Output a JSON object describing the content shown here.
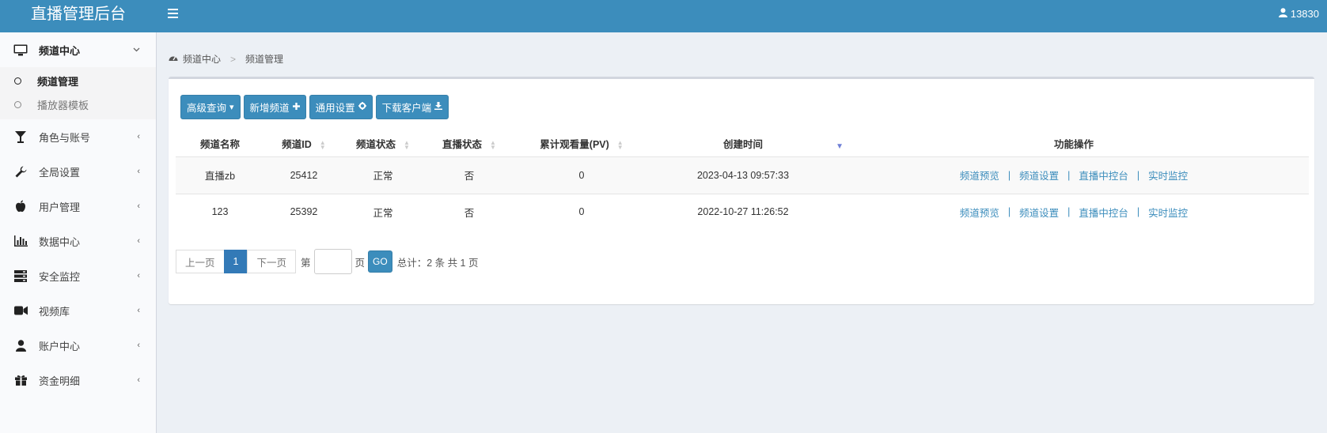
{
  "app": {
    "title": "直播管理后台",
    "user": "13830"
  },
  "sidebar": {
    "items": [
      {
        "label": "频道中心",
        "icon": "monitor-icon",
        "open": true,
        "sub": [
          {
            "label": "频道管理",
            "active": true
          },
          {
            "label": "播放器模板",
            "active": false
          }
        ]
      },
      {
        "label": "角色与账号",
        "icon": "glass-icon"
      },
      {
        "label": "全局设置",
        "icon": "wrench-icon"
      },
      {
        "label": "用户管理",
        "icon": "apple-icon"
      },
      {
        "label": "数据中心",
        "icon": "bar-chart-icon"
      },
      {
        "label": "安全监控",
        "icon": "server-icon"
      },
      {
        "label": "视频库",
        "icon": "video-camera-icon"
      },
      {
        "label": "账户中心",
        "icon": "user-icon"
      },
      {
        "label": "资金明细",
        "icon": "gift-icon"
      }
    ]
  },
  "breadcrumb": {
    "root": "频道中心",
    "sep": ">",
    "current": "频道管理"
  },
  "toolbar": {
    "advanced_search": "高级查询",
    "new_channel": "新增频道",
    "general_settings": "通用设置",
    "download_client": "下载客户端"
  },
  "table": {
    "columns": [
      "频道名称",
      "频道ID",
      "频道状态",
      "直播状态",
      "累计观看量(PV)",
      "创建时间",
      "功能操作"
    ],
    "rows": [
      {
        "name": "直播zb",
        "id": "25412",
        "status": "正常",
        "live": "否",
        "pv": "0",
        "created": "2023-04-13 09:57:33"
      },
      {
        "name": "123",
        "id": "25392",
        "status": "正常",
        "live": "否",
        "pv": "0",
        "created": "2022-10-27 11:26:52"
      }
    ],
    "ops": [
      "频道预览",
      "频道设置",
      "直播中控台",
      "实时监控"
    ],
    "ops_sep": "|"
  },
  "pager": {
    "prev": "上一页",
    "current": "1",
    "next": "下一页",
    "goto_prefix": "第",
    "goto_suffix": "页",
    "go": "GO",
    "summary": "总计：2 条 共 1 页"
  },
  "colors": {
    "primary": "#3c8dbc",
    "link": "#3c8dbc",
    "background": "#ecf0f5"
  }
}
